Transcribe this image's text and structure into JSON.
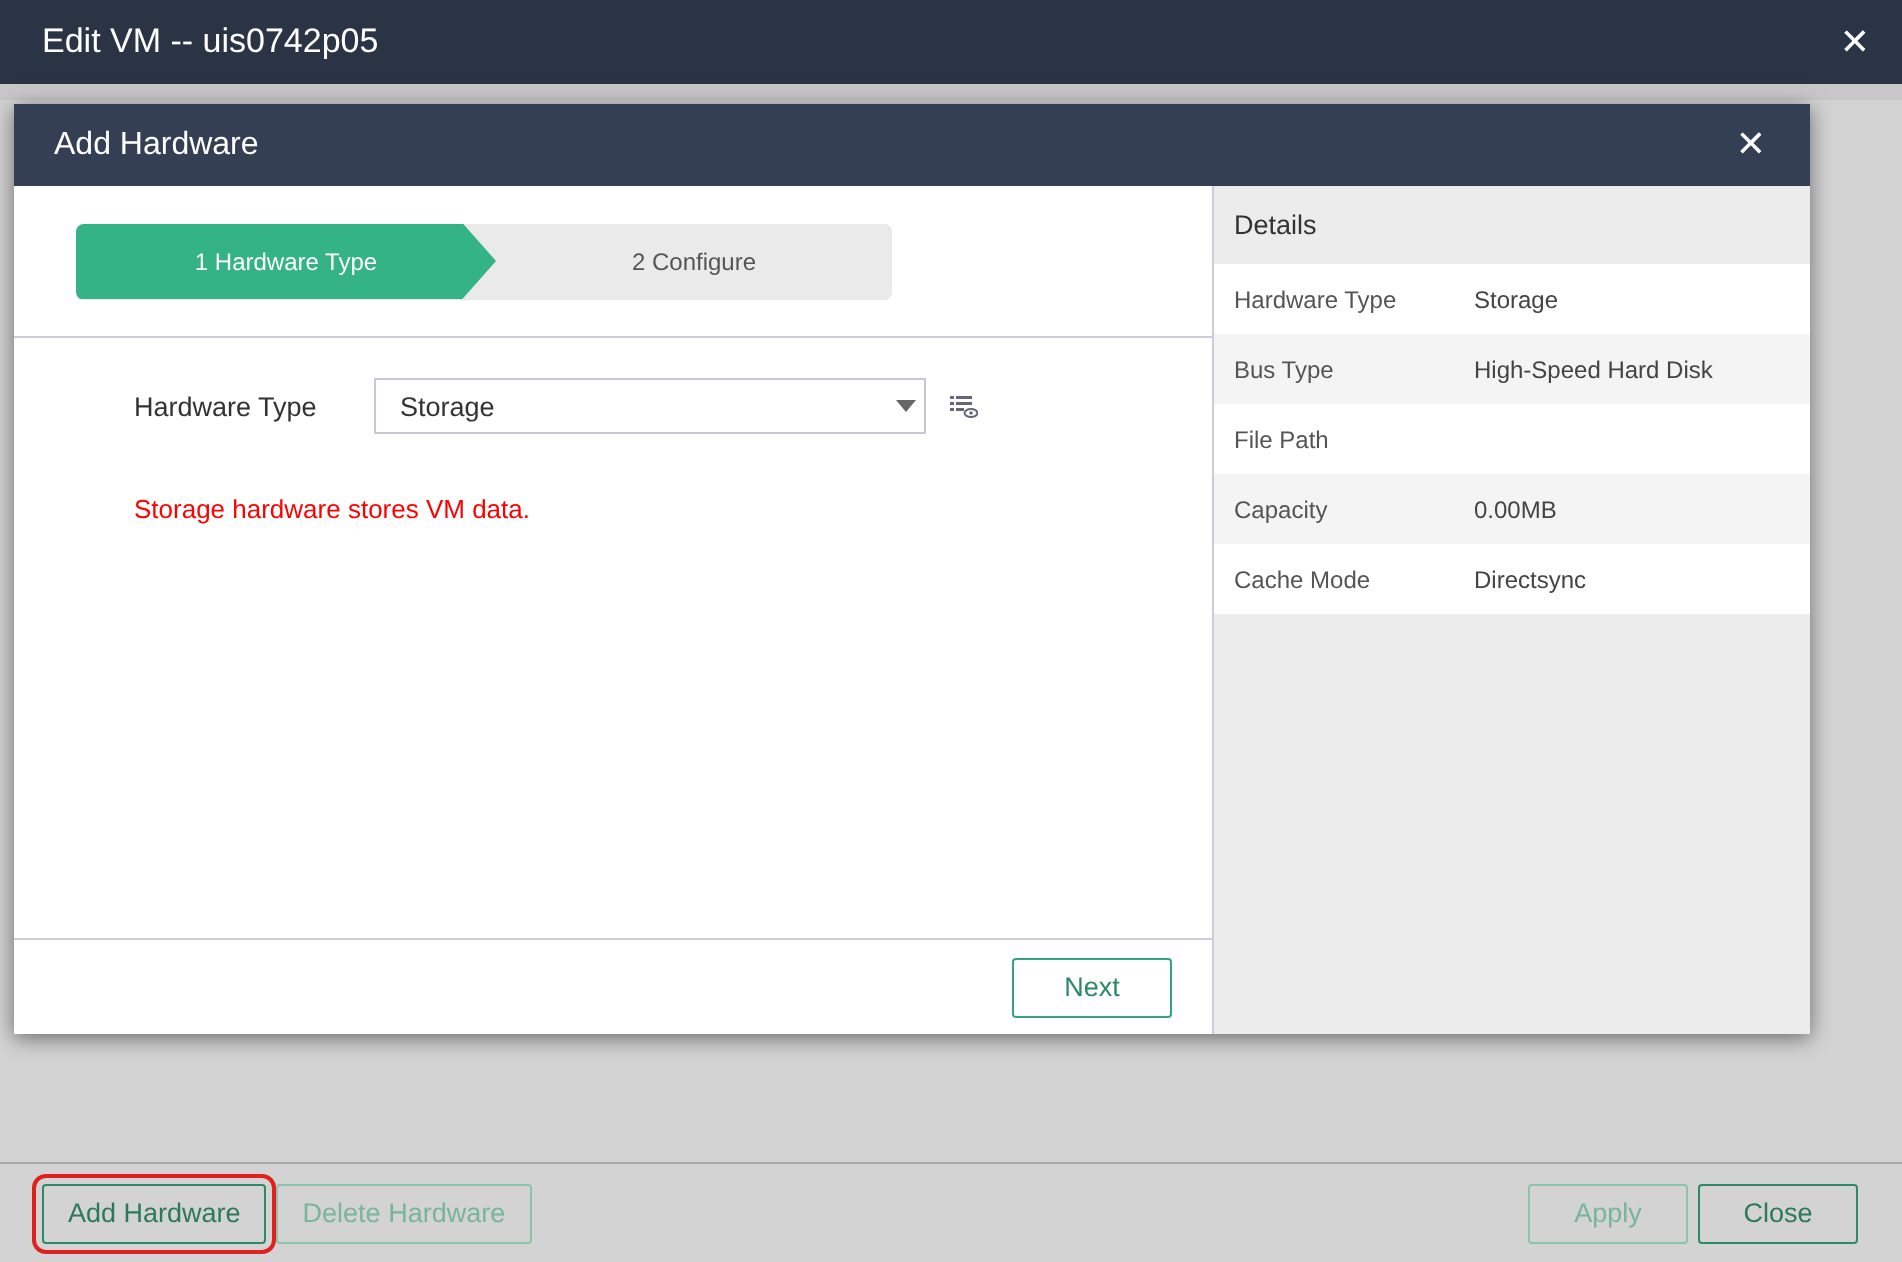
{
  "window": {
    "title": "Edit VM -- uis0742p05",
    "close": "✕"
  },
  "dialog": {
    "title": "Add Hardware",
    "close": "✕",
    "steps": [
      {
        "label": "1 Hardware Type",
        "selected": true
      },
      {
        "label": "2 Configure",
        "selected": false
      }
    ],
    "field": {
      "label": "Hardware Type",
      "value": "Storage"
    },
    "hint": "Storage hardware stores VM data.",
    "next": "Next",
    "details": {
      "title": "Details",
      "rows": [
        {
          "label": "Hardware Type",
          "value": "Storage"
        },
        {
          "label": "Bus Type",
          "value": "High-Speed Hard Disk"
        },
        {
          "label": "File Path"
        },
        {
          "label": "Capacity",
          "value": "0.00MB"
        },
        {
          "label": "Cache Mode",
          "value": "Directsync"
        }
      ]
    }
  },
  "footer": {
    "left": [
      {
        "label": "Add Hardware",
        "disabled": false,
        "highlighted": true
      },
      {
        "label": "Delete Hardware",
        "disabled": true,
        "highlighted": false
      }
    ],
    "right": [
      {
        "label": "Apply",
        "disabled": true,
        "highlighted": false
      },
      {
        "label": "Close",
        "disabled": false,
        "highlighted": false
      }
    ]
  }
}
